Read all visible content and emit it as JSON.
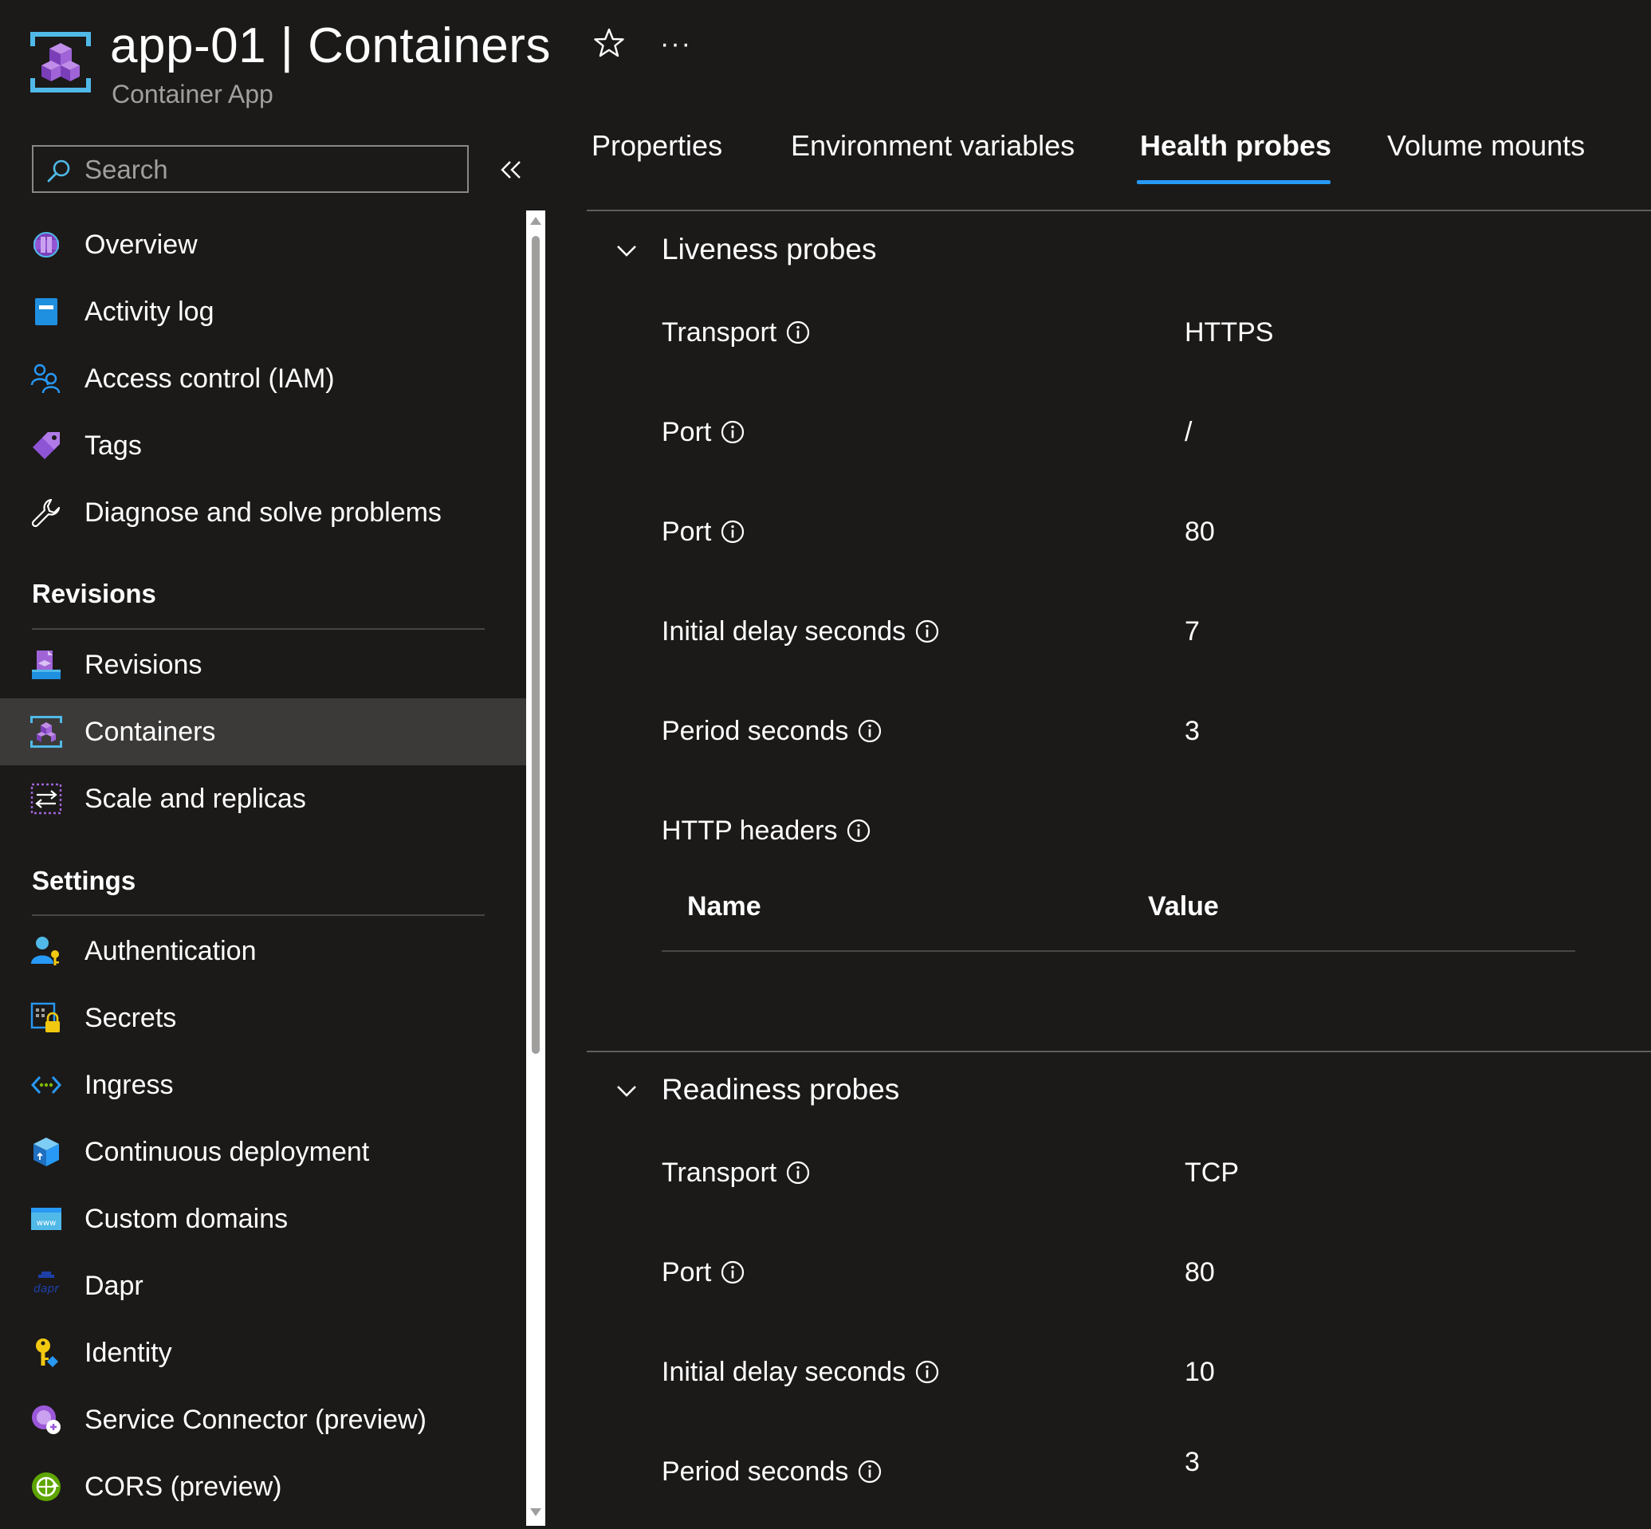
{
  "header": {
    "title": "app-01 | Containers",
    "subtitle": "Container App",
    "favorite_icon": "star-icon",
    "more_label": "···"
  },
  "search": {
    "placeholder": "Search",
    "value": ""
  },
  "sidebar": {
    "top_items": [
      {
        "label": "Overview",
        "icon": "overview-icon"
      },
      {
        "label": "Activity log",
        "icon": "activity-log-icon"
      },
      {
        "label": "Access control (IAM)",
        "icon": "people-icon"
      },
      {
        "label": "Tags",
        "icon": "tag-icon"
      },
      {
        "label": "Diagnose and solve problems",
        "icon": "wrench-icon"
      }
    ],
    "revisions_section": {
      "title": "Revisions",
      "items": [
        {
          "label": "Revisions",
          "icon": "revisions-icon"
        },
        {
          "label": "Containers",
          "icon": "containers-icon",
          "selected": true
        },
        {
          "label": "Scale and replicas",
          "icon": "scale-icon"
        }
      ]
    },
    "settings_section": {
      "title": "Settings",
      "items": [
        {
          "label": "Authentication",
          "icon": "user-key-icon"
        },
        {
          "label": "Secrets",
          "icon": "lock-icon"
        },
        {
          "label": "Ingress",
          "icon": "code-arrows-icon"
        },
        {
          "label": "Continuous deployment",
          "icon": "cube-icon"
        },
        {
          "label": "Custom domains",
          "icon": "www-icon"
        },
        {
          "label": "Dapr",
          "icon": "dapr-icon"
        },
        {
          "label": "Identity",
          "icon": "key-icon"
        },
        {
          "label": "Service Connector (preview)",
          "icon": "plug-icon"
        },
        {
          "label": "CORS (preview)",
          "icon": "cors-icon"
        }
      ]
    }
  },
  "tabs": [
    {
      "label": "Properties"
    },
    {
      "label": "Environment variables"
    },
    {
      "label": "Health probes",
      "active": true
    },
    {
      "label": "Volume mounts"
    }
  ],
  "liveness": {
    "title": "Liveness probes",
    "fields": [
      {
        "label": "Transport",
        "value": "HTTPS"
      },
      {
        "label": "Port",
        "value": "/"
      },
      {
        "label": "Port",
        "value": "80"
      },
      {
        "label": "Initial delay seconds",
        "value": "7"
      },
      {
        "label": "Period seconds",
        "value": "3"
      }
    ],
    "http_headers_label": "HTTP headers",
    "table": {
      "columns": [
        "Name",
        "Value"
      ]
    }
  },
  "readiness": {
    "title": "Readiness probes",
    "fields": [
      {
        "label": "Transport",
        "value": "TCP"
      },
      {
        "label": "Port",
        "value": "80"
      },
      {
        "label": "Initial delay seconds",
        "value": "10"
      },
      {
        "label": "Period seconds",
        "value": "3"
      }
    ]
  },
  "colors": {
    "background": "#1b1a19",
    "accent": "#2899f5",
    "selected_nav": "#3b3a39",
    "muted_text": "#a19f9d"
  }
}
